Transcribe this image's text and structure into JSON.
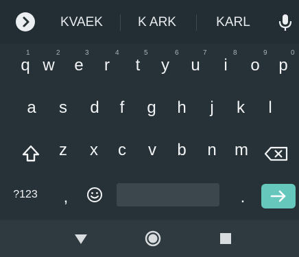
{
  "suggestions": {
    "items": [
      "KVAEK",
      "K ARK",
      "KARL"
    ]
  },
  "keyboard": {
    "row1": [
      {
        "key": "q",
        "hint": "1"
      },
      {
        "key": "w",
        "hint": "2"
      },
      {
        "key": "e",
        "hint": "3"
      },
      {
        "key": "r",
        "hint": "4"
      },
      {
        "key": "t",
        "hint": "5"
      },
      {
        "key": "y",
        "hint": "6"
      },
      {
        "key": "u",
        "hint": "7"
      },
      {
        "key": "i",
        "hint": "8"
      },
      {
        "key": "o",
        "hint": "9"
      },
      {
        "key": "p",
        "hint": "0"
      }
    ],
    "row2": [
      "a",
      "s",
      "d",
      "f",
      "g",
      "h",
      "j",
      "k",
      "l"
    ],
    "row3": [
      "z",
      "x",
      "c",
      "v",
      "b",
      "n",
      "m"
    ],
    "row4": {
      "symbols": "?123",
      "comma": ",",
      "period": "."
    }
  },
  "colors": {
    "background": "#263238",
    "accent": "#66c7bd",
    "text": "#f2f4f5"
  }
}
